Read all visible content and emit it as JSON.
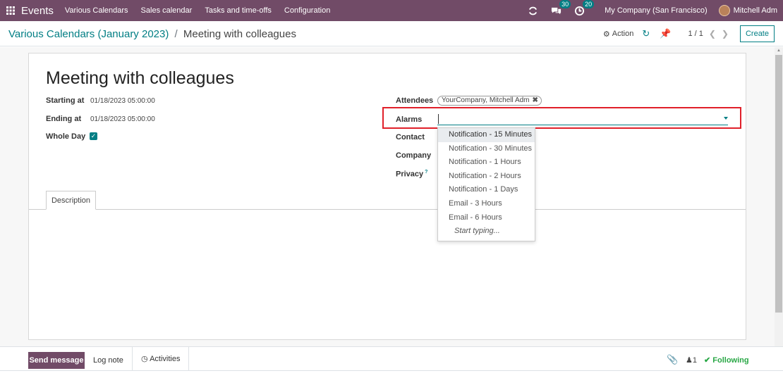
{
  "navbar": {
    "brand": "Events",
    "menus": [
      "Various Calendars",
      "Sales calendar",
      "Tasks and time-offs",
      "Configuration"
    ],
    "messages_count": "30",
    "activities_count": "20",
    "company": "My Company (San Francisco)",
    "user": "Mitchell Adm"
  },
  "control": {
    "breadcrumb_parent": "Various Calendars (January 2023)",
    "breadcrumb_sep": "/",
    "breadcrumb_current": "Meeting with colleagues",
    "action_label": "Action",
    "pager": "1 / 1",
    "create_label": "Create"
  },
  "form": {
    "title": "Meeting with colleagues",
    "starting_label": "Starting at",
    "starting_value": "01/18/2023 05:00:00",
    "ending_label": "Ending at",
    "ending_value": "01/18/2023 05:00:00",
    "whole_day_label": "Whole Day",
    "whole_day_checked": true,
    "attendees_label": "Attendees",
    "attendee_tag": "YourCompany, Mitchell Adm",
    "alarms_label": "Alarms",
    "contact_label": "Contact",
    "company_label": "Company",
    "privacy_label": "Privacy",
    "privacy_help": "?",
    "tab_description": "Description"
  },
  "alarm_dropdown": {
    "options": [
      "Notification - 15 Minutes",
      "Notification - 30 Minutes",
      "Notification - 1 Hours",
      "Notification - 2 Hours",
      "Notification - 1 Days",
      "Email - 3 Hours",
      "Email - 6 Hours"
    ],
    "start_typing": "Start typing..."
  },
  "chatter": {
    "send_message": "Send message",
    "log_note": "Log note",
    "activities": "Activities",
    "followers_count": "1",
    "following": "Following"
  },
  "colors": {
    "brand": "#714B67",
    "accent": "#017E84",
    "highlight": "#e0202a",
    "following": "#28a745"
  }
}
